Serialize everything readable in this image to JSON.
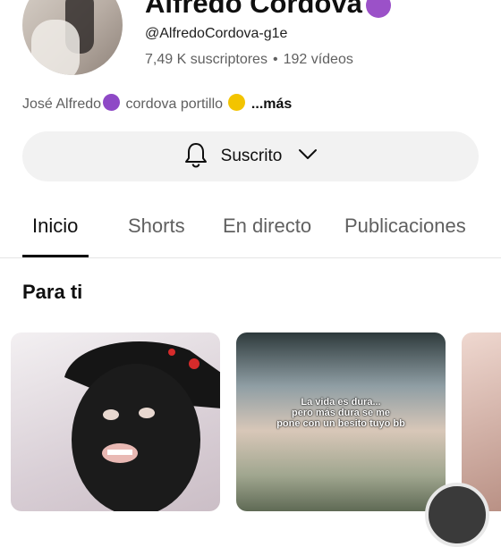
{
  "channel": {
    "name": "Alfredo Cordova",
    "handle": "@AlfredoCordova-g1e",
    "subscribers": "7,49 K suscriptores",
    "separator": "•",
    "videos": "192 vídeos",
    "description": {
      "part1": "José Alfredo",
      "part2": "cordova portillo",
      "more": "...más"
    }
  },
  "subscribe": {
    "label": "Suscrito",
    "icon": "bell-icon",
    "dropdown_icon": "chevron-down-icon"
  },
  "tabs": [
    {
      "label": "Inicio",
      "active": true
    },
    {
      "label": "Shorts",
      "active": false
    },
    {
      "label": "En directo",
      "active": false
    },
    {
      "label": "Publicaciones",
      "active": false
    }
  ],
  "section": {
    "title": "Para ti"
  },
  "videos": [
    {
      "overlay": []
    },
    {
      "overlay": [
        "La vida es dura...",
        "pero más dura se me",
        "pone con un besito tuyo bb"
      ]
    },
    {
      "overlay": []
    }
  ],
  "colors": {
    "accent": "#0f0f0f",
    "muted": "#606060",
    "button_bg": "#f2f2f2"
  }
}
